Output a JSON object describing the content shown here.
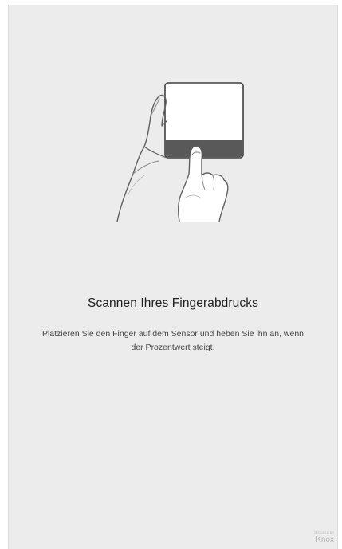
{
  "screen": {
    "title": "Scannen Ihres Fingerabdrucks",
    "description": "Platzieren Sie den Finger auf dem Sensor und heben Sie ihn an, wenn der Prozentwert steigt.",
    "illustration_icon": "hand-holding-tablet-finger-on-sensor-icon"
  },
  "branding": {
    "secured_by": "SECURED BY",
    "logo_text": "Knox"
  },
  "colors": {
    "background": "#ececec",
    "title": "#1e1e1e",
    "description": "#454545",
    "logo": "#b5b5b5"
  }
}
